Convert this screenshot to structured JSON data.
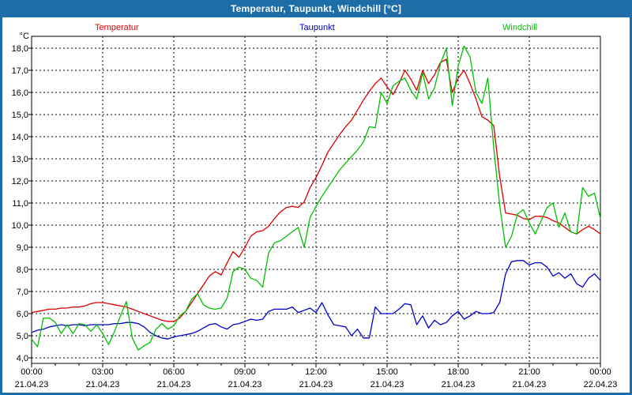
{
  "window": {
    "title": "Temperatur, Taupunkt, Windchill [°C]"
  },
  "colors": {
    "titlebar": "#1d6da8",
    "window_border": "#1d6da8",
    "plot_border": "#000000",
    "grid": "#000000",
    "temperatur": "#dd0000",
    "taupunkt": "#0000cc",
    "windchill": "#00c000",
    "text": "#000000"
  },
  "legend": {
    "items": [
      {
        "label": "Temperatur",
        "color": "#dd0000",
        "x": 117
      },
      {
        "label": "Taupunkt",
        "color": "#0000cc",
        "x": 376
      },
      {
        "label": "Windchill",
        "color": "#00c000",
        "x": 633
      }
    ]
  },
  "chart_data": {
    "type": "line",
    "title": "Temperatur, Taupunkt, Windchill [°C]",
    "ylabel": "°C",
    "ylim": [
      4.0,
      18.0
    ],
    "ytick_step": 1.0,
    "ytick_labels": [
      "18,0",
      "17,0",
      "16,0",
      "15,0",
      "14,0",
      "13,0",
      "12,0",
      "11,0",
      "10,0",
      "9,0",
      "8,0",
      "7,0",
      "6,0",
      "5,0",
      "4,0"
    ],
    "x_span_hours": 24,
    "x_step_hours": 0.25,
    "xticks": [
      {
        "time": "00:00",
        "date": "21.04.23"
      },
      {
        "time": "03:00",
        "date": "21.04.23"
      },
      {
        "time": "06:00",
        "date": "21.04.23"
      },
      {
        "time": "09:00",
        "date": "21.04.23"
      },
      {
        "time": "12:00",
        "date": "21.04.23"
      },
      {
        "time": "15:00",
        "date": "21.04.23"
      },
      {
        "time": "18:00",
        "date": "21.04.23"
      },
      {
        "time": "21:00",
        "date": "21.04.23"
      },
      {
        "time": "00:00",
        "date": "22.04.23"
      }
    ],
    "grid": "dashed",
    "legend_position": "top",
    "series": [
      {
        "name": "Temperatur",
        "color": "#dd0000",
        "values": [
          6.05,
          6.1,
          6.15,
          6.2,
          6.2,
          6.25,
          6.25,
          6.3,
          6.3,
          6.35,
          6.45,
          6.5,
          6.5,
          6.45,
          6.4,
          6.35,
          6.3,
          6.2,
          6.1,
          6.0,
          5.9,
          5.8,
          5.7,
          5.65,
          5.65,
          5.8,
          6.1,
          6.5,
          6.9,
          7.3,
          7.7,
          7.9,
          7.75,
          8.3,
          8.8,
          8.55,
          9.0,
          9.5,
          9.7,
          9.75,
          9.95,
          10.3,
          10.6,
          10.8,
          10.85,
          10.8,
          11.05,
          11.7,
          12.15,
          12.7,
          13.3,
          13.7,
          14.1,
          14.45,
          14.75,
          15.2,
          15.65,
          16.05,
          16.4,
          16.65,
          16.25,
          15.9,
          16.4,
          17.0,
          16.6,
          16.1,
          17.0,
          16.4,
          16.8,
          17.35,
          17.5,
          16.0,
          16.65,
          17.0,
          16.4,
          15.7,
          14.9,
          14.75,
          14.5,
          12.2,
          10.55,
          10.5,
          10.45,
          10.3,
          10.25,
          10.4,
          10.4,
          10.35,
          10.2,
          10.1,
          9.9,
          9.7,
          9.6,
          9.8,
          9.95,
          9.8,
          9.6
        ]
      },
      {
        "name": "Taupunkt",
        "color": "#0000cc",
        "values": [
          5.15,
          5.25,
          5.3,
          5.4,
          5.45,
          5.5,
          5.45,
          5.5,
          5.5,
          5.45,
          5.5,
          5.5,
          5.5,
          5.5,
          5.55,
          5.55,
          5.6,
          5.6,
          5.55,
          5.4,
          5.15,
          5.0,
          4.9,
          4.85,
          4.95,
          5.0,
          5.05,
          5.1,
          5.2,
          5.35,
          5.5,
          5.55,
          5.4,
          5.3,
          5.5,
          5.55,
          5.65,
          5.75,
          5.7,
          5.75,
          6.1,
          6.2,
          6.2,
          6.2,
          6.3,
          6.05,
          6.15,
          6.25,
          6.05,
          6.5,
          5.95,
          5.5,
          5.45,
          5.4,
          5.0,
          5.3,
          4.9,
          4.9,
          6.3,
          6.0,
          6.0,
          6.0,
          6.2,
          6.45,
          6.4,
          5.5,
          5.9,
          5.35,
          5.7,
          5.5,
          5.6,
          5.9,
          6.1,
          5.75,
          5.9,
          6.1,
          6.0,
          6.0,
          6.05,
          6.5,
          7.8,
          8.35,
          8.4,
          8.4,
          8.2,
          8.3,
          8.3,
          8.1,
          7.7,
          7.85,
          7.6,
          7.8,
          7.35,
          7.2,
          7.6,
          7.8,
          7.5
        ]
      },
      {
        "name": "Windchill",
        "color": "#00c000",
        "values": [
          4.85,
          4.5,
          5.8,
          5.8,
          5.6,
          5.1,
          5.5,
          5.1,
          5.55,
          5.5,
          5.2,
          5.5,
          5.1,
          4.6,
          5.2,
          5.9,
          6.55,
          4.9,
          4.35,
          4.55,
          4.7,
          5.3,
          5.55,
          5.3,
          5.45,
          5.9,
          6.1,
          6.65,
          6.9,
          6.4,
          6.25,
          6.2,
          6.25,
          6.7,
          7.9,
          8.1,
          8.0,
          7.6,
          7.5,
          7.2,
          8.75,
          9.2,
          9.3,
          9.5,
          9.7,
          9.9,
          9.0,
          10.35,
          10.85,
          11.3,
          11.7,
          12.1,
          12.5,
          12.8,
          13.1,
          13.4,
          13.75,
          14.45,
          14.4,
          16.0,
          15.5,
          16.3,
          16.5,
          16.65,
          16.1,
          15.7,
          16.9,
          15.7,
          16.2,
          17.3,
          18.0,
          15.4,
          17.2,
          18.1,
          17.6,
          16.0,
          15.5,
          16.65,
          13.5,
          10.9,
          9.0,
          9.5,
          10.5,
          10.7,
          10.1,
          9.6,
          10.2,
          10.8,
          11.0,
          9.9,
          10.55,
          9.7,
          9.6,
          11.7,
          11.3,
          11.45,
          10.3
        ]
      }
    ]
  }
}
